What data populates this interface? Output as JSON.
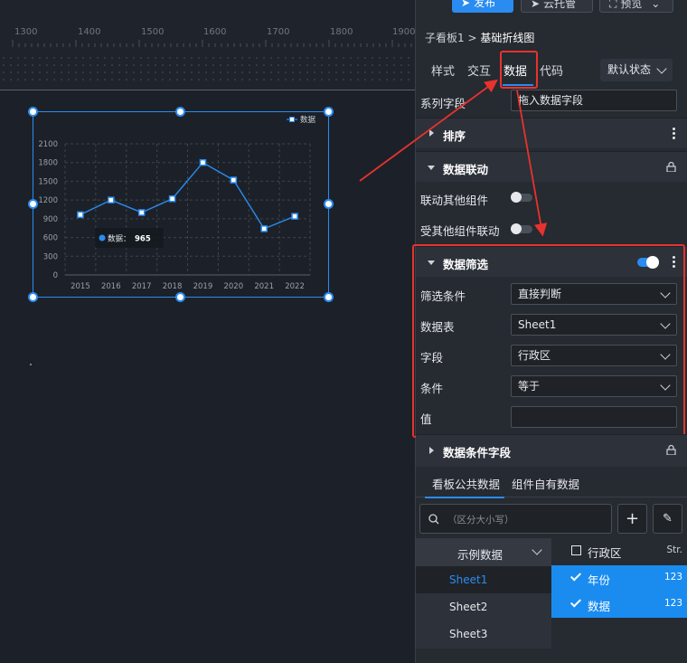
{
  "ruler": {
    "labels": [
      "1300",
      "1400",
      "1500",
      "1600",
      "1700",
      "1800",
      "1900"
    ]
  },
  "topbar": {
    "publish_label": "发布",
    "cloud_label": "云托管",
    "preview_label": "预览"
  },
  "breadcrumb": {
    "parent": "子看板1",
    "separator": " > ",
    "current": "基础折线图"
  },
  "tabs": {
    "style": "样式",
    "interaction": "交互",
    "data": "数据",
    "code": "代码",
    "state": "默认状态"
  },
  "series": {
    "label": "系列字段",
    "placeholder": "拖入数据字段"
  },
  "sections": {
    "sort": "排序",
    "linkage": "数据联动",
    "link_others": "联动其他组件",
    "linked_by": "受其他组件联动",
    "filter": "数据筛选",
    "condition_fields": "数据条件字段"
  },
  "filter": {
    "condition_label": "筛选条件",
    "condition_value": "直接判断",
    "table_label": "数据表",
    "table_value": "Sheet1",
    "field_label": "字段",
    "field_value": "行政区",
    "op_label": "条件",
    "op_value": "等于",
    "value_label": "值",
    "value_value": ""
  },
  "subtabs": {
    "public": "看板公共数据",
    "own": "组件自有数据"
  },
  "search": {
    "placeholder": "（区分大小写）"
  },
  "datasets": {
    "header": "示例数据",
    "sheets": [
      "Sheet1",
      "Sheet2",
      "Sheet3"
    ]
  },
  "fields": [
    {
      "name": "行政区",
      "type": "Str.",
      "checked": false
    },
    {
      "name": "年份",
      "type": "123",
      "checked": true
    },
    {
      "name": "数据",
      "type": "123",
      "checked": true
    }
  ],
  "colors": {
    "accent": "#2a8cf0",
    "annotation": "#e8322d",
    "line": "#2a8cf0"
  },
  "chart_data": {
    "type": "line",
    "categories": [
      "2015",
      "2016",
      "2017",
      "2018",
      "2019",
      "2020",
      "2021",
      "2022"
    ],
    "series": [
      {
        "name": "数据",
        "values": [
          965,
          1200,
          1000,
          1220,
          1800,
          1520,
          740,
          940
        ]
      }
    ],
    "ylim": [
      0,
      2100
    ],
    "yticks": [
      "0",
      "300",
      "600",
      "900",
      "1200",
      "1500",
      "1800",
      "2100"
    ],
    "tooltip": {
      "label": "数据：",
      "value": "965"
    },
    "grid": true,
    "legend": "top-right"
  }
}
